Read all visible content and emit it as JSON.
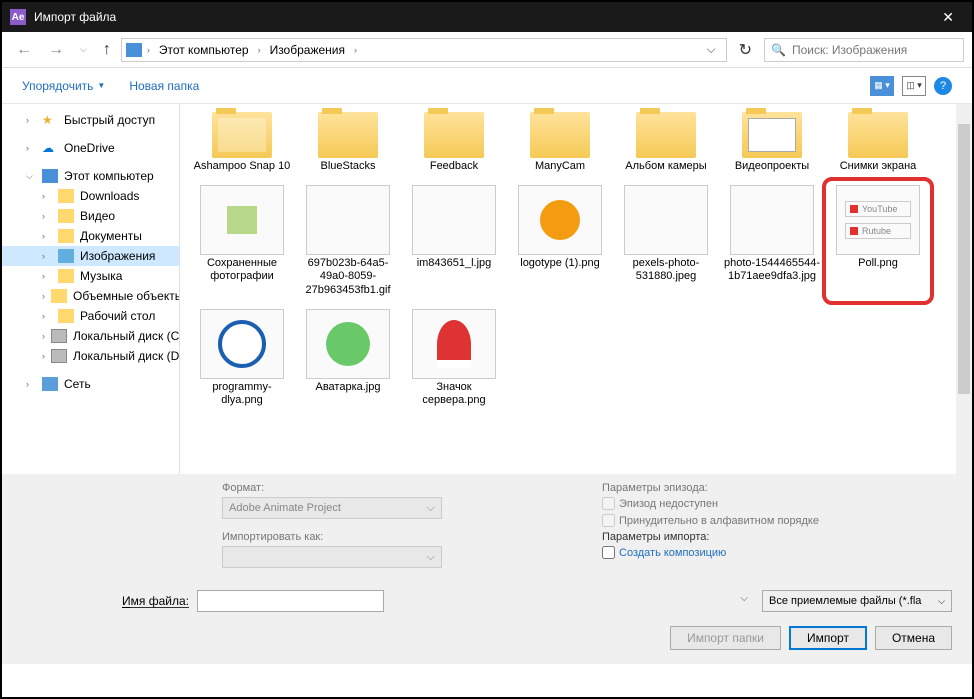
{
  "title": "Импорт файла",
  "breadcrumb": {
    "pc": "Этот компьютер",
    "loc": "Изображения"
  },
  "search_placeholder": "Поиск: Изображения",
  "toolbar": {
    "organize": "Упорядочить",
    "newfolder": "Новая папка"
  },
  "sidebar": {
    "quick": "Быстрый доступ",
    "onedrive": "OneDrive",
    "pc": "Этот компьютер",
    "downloads": "Downloads",
    "video": "Видео",
    "documents": "Документы",
    "images": "Изображения",
    "music": "Музыка",
    "objects3d": "Объемные объекты",
    "desktop": "Рабочий стол",
    "diskc": "Локальный диск (C:)",
    "diskd": "Локальный диск (D:)",
    "network": "Сеть"
  },
  "files": {
    "f1": "Ashampoo Snap 10",
    "f2": "BlueStacks",
    "f3": "Feedback",
    "f4": "ManyCam",
    "f5": "Альбом камеры",
    "f6": "Видеопроекты",
    "f7": "Снимки экрана",
    "f8": "Сохраненные фотографии",
    "f9": "697b023b-64a5-49a0-8059-27b963453fb1.gif",
    "f10": "im843651_l.jpg",
    "f11": "logotype (1).png",
    "f12": "pexels-photo-531880.jpeg",
    "f13": "photo-1544465544-1b71aee9dfa3.jpg",
    "f14": "Poll.png",
    "f15": "programmy-dlya.png",
    "f16": "Аватарка.jpg",
    "f17": "Значок сервера.png",
    "poll_a": "YouTube",
    "poll_b": "Rutube"
  },
  "panel": {
    "format_lbl": "Формат:",
    "format_val": "Adobe Animate Project",
    "importas_lbl": "Импортировать как:",
    "episode_lbl": "Параметры эпизода:",
    "episode_unavail": "Эпизод недоступен",
    "force_alpha": "Принудительно в алфавитном порядке",
    "import_params": "Параметры импорта:",
    "create_comp": "Создать композицию"
  },
  "footer": {
    "filename_lbl": "Имя файла:",
    "filetype": "Все приемлемые файлы (*.fla",
    "import_folder": "Импорт папки",
    "import": "Импорт",
    "cancel": "Отмена"
  }
}
